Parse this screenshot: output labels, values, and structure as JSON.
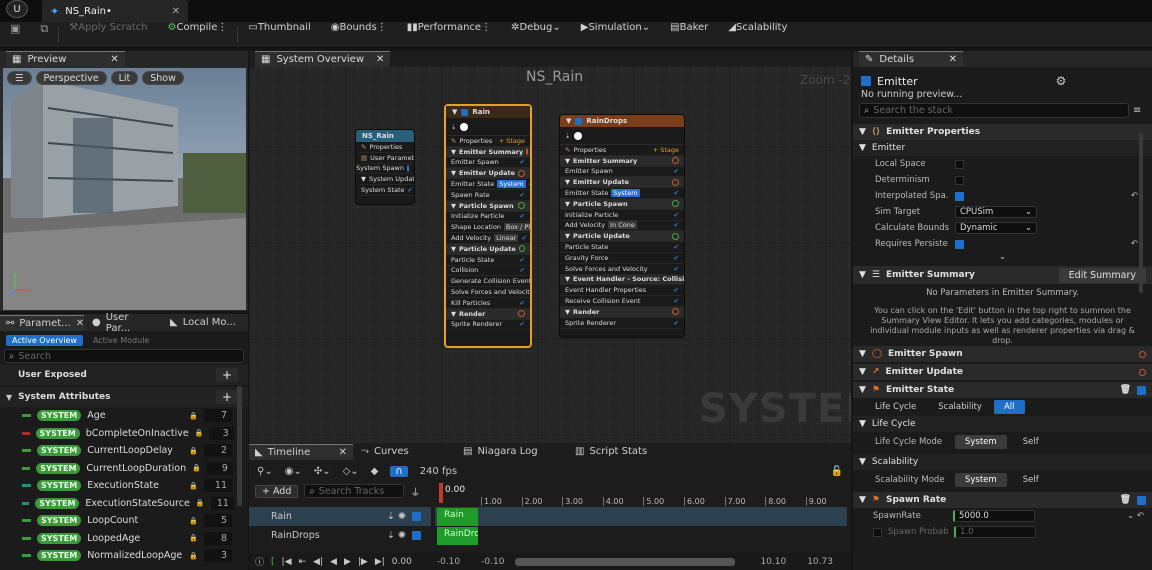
{
  "app": {
    "logo": "U",
    "doc_tab": "NS_Rain•"
  },
  "toolbar": {
    "apply_scratch": "Apply Scratch",
    "compile": "Compile",
    "thumbnail": "Thumbnail",
    "bounds": "Bounds",
    "performance": "Performance",
    "debug": "Debug",
    "simulation": "Simulation",
    "baker": "Baker",
    "scalability": "Scalability"
  },
  "preview": {
    "tab": "Preview",
    "perspective": "Perspective",
    "lit": "Lit",
    "show": "Show"
  },
  "params": {
    "tabs": [
      "Paramet...",
      "User Par...",
      "Local Mo..."
    ],
    "active_overview": "Active Overview",
    "active_module": "Active Module",
    "search_placeholder": "Search",
    "user_exposed": "User Exposed",
    "system_attributes": "System Attributes",
    "badge": "SYSTEM",
    "rows": [
      {
        "name": "Age",
        "value": "7",
        "color": "#3c9a3c"
      },
      {
        "name": "bCompleteOnInactive",
        "value": "3",
        "color": "#b22a2a"
      },
      {
        "name": "CurrentLoopDelay",
        "value": "2",
        "color": "#3c9a3c"
      },
      {
        "name": "CurrentLoopDuration",
        "value": "9",
        "color": "#3c9a3c"
      },
      {
        "name": "ExecutionState",
        "value": "11",
        "color": "#2e8c7a"
      },
      {
        "name": "ExecutionStateSource",
        "value": "11",
        "color": "#2e8c7a"
      },
      {
        "name": "LoopCount",
        "value": "5",
        "color": "#3c9a3c"
      },
      {
        "name": "LoopedAge",
        "value": "8",
        "color": "#3c9a3c"
      },
      {
        "name": "NormalizedLoopAge",
        "value": "3",
        "color": "#3c9a3c"
      }
    ]
  },
  "graph": {
    "tab": "System Overview",
    "title": "NS_Rain",
    "zoom": "Zoom -2",
    "watermark": "SYSTEM",
    "sys_node": {
      "title": "NS_Rain",
      "rows": [
        "Properties",
        "User Parameters",
        "System Spawn",
        "System Update",
        "System State"
      ]
    },
    "rain": {
      "title": "Rain",
      "properties": "Properties",
      "stage": "+ Stage",
      "rows": [
        [
          "sec",
          "Emitter Summary"
        ],
        [
          "item",
          "Emitter Spawn"
        ],
        [
          "sec",
          "Emitter Update"
        ],
        [
          "tag",
          "Emitter State",
          "System"
        ],
        [
          "item",
          "Spawn Rate"
        ],
        [
          "sec",
          "Particle Spawn"
        ],
        [
          "item",
          "Initialize Particle"
        ],
        [
          "tag2",
          "Shape Location",
          "Box / Plane"
        ],
        [
          "tag2",
          "Add Velocity",
          "Linear"
        ],
        [
          "sec",
          "Particle Update"
        ],
        [
          "item",
          "Particle State"
        ],
        [
          "item",
          "Collision"
        ],
        [
          "item",
          "Generate Collision Event"
        ],
        [
          "item",
          "Solve Forces and Velocity"
        ],
        [
          "item",
          "Kill Particles"
        ],
        [
          "sec",
          "Render"
        ],
        [
          "item",
          "Sprite Renderer"
        ]
      ]
    },
    "drops": {
      "title": "RainDrops",
      "properties": "Properties",
      "stage": "+ Stage",
      "rows": [
        [
          "sec",
          "Emitter Summary"
        ],
        [
          "item",
          "Emitter Spawn"
        ],
        [
          "sec",
          "Emitter Update"
        ],
        [
          "tag",
          "Emitter State",
          "System"
        ],
        [
          "sec",
          "Particle Spawn"
        ],
        [
          "item",
          "Initialize Particle"
        ],
        [
          "tag2",
          "Add Velocity",
          "In Cone"
        ],
        [
          "sec",
          "Particle Update"
        ],
        [
          "item",
          "Particle State"
        ],
        [
          "item",
          "Gravity Force"
        ],
        [
          "item",
          "Solve Forces and Velocity"
        ],
        [
          "sec",
          "Event Handler - Source: CollisionEvent"
        ],
        [
          "item",
          "Event Handler Properties"
        ],
        [
          "item",
          "Receive Collision Event"
        ],
        [
          "sec",
          "Render"
        ],
        [
          "item",
          "Sprite Renderer"
        ]
      ]
    }
  },
  "timeline": {
    "tabs": [
      "Timeline",
      "Curves",
      "Niagara Log",
      "Script Stats"
    ],
    "fps": "240 fps",
    "add": "+ Add",
    "search_placeholder": "Search Tracks",
    "playhead": "0.00",
    "ticks": [
      "1.00",
      "2.00",
      "3.00",
      "4.00",
      "5.00",
      "6.00",
      "7.00",
      "8.00",
      "9.00"
    ],
    "tracks": [
      "Rain",
      "RainDrops"
    ],
    "bar_labels": [
      "Rain",
      "RainDro"
    ],
    "time": "0.00",
    "range": [
      "-0.10",
      "-0.10",
      "10.10",
      "10.73"
    ]
  },
  "details": {
    "tab": "Details",
    "emitter": "Emitter",
    "status": "No running preview...",
    "search_placeholder": "Search the stack",
    "emitter_props": "Emitter Properties",
    "props": [
      [
        "Local Space",
        "box",
        ""
      ],
      [
        "Determinism",
        "box",
        ""
      ],
      [
        "Interpolated Spa...",
        "boxon",
        ""
      ],
      [
        "Sim Target",
        "combo",
        "CPUSim"
      ],
      [
        "Calculate Bounds...",
        "combo",
        "Dynamic"
      ],
      [
        "Requires Persiste...",
        "boxon",
        ""
      ]
    ],
    "summary_title": "Emitter Summary",
    "edit_summary": "Edit Summary",
    "no_params": "No Parameters in Emitter Summary.",
    "summary_help": "You can click on the 'Edit' button in the top right to summon the Summary View Editor. It lets you add categories, modules or individual module inputs as well as renderer properties via drag & drop.",
    "emitter_spawn": "Emitter Spawn",
    "emitter_update": "Emitter Update",
    "emitter_state": "Emitter State",
    "state_tabs": [
      "Life Cycle",
      "Scalability",
      "All"
    ],
    "life_cycle": "Life Cycle",
    "life_cycle_mode": "Life Cycle Mode",
    "scalability": "Scalability",
    "scalability_mode": "Scalability Mode",
    "system": "System",
    "self": "Self",
    "spawn_rate": "Spawn Rate",
    "spawn_rate_label": "SpawnRate",
    "spawn_rate_value": "5000.0",
    "spawn_prob": "Spawn Probabi",
    "spawn_prob_value": "1.0"
  }
}
